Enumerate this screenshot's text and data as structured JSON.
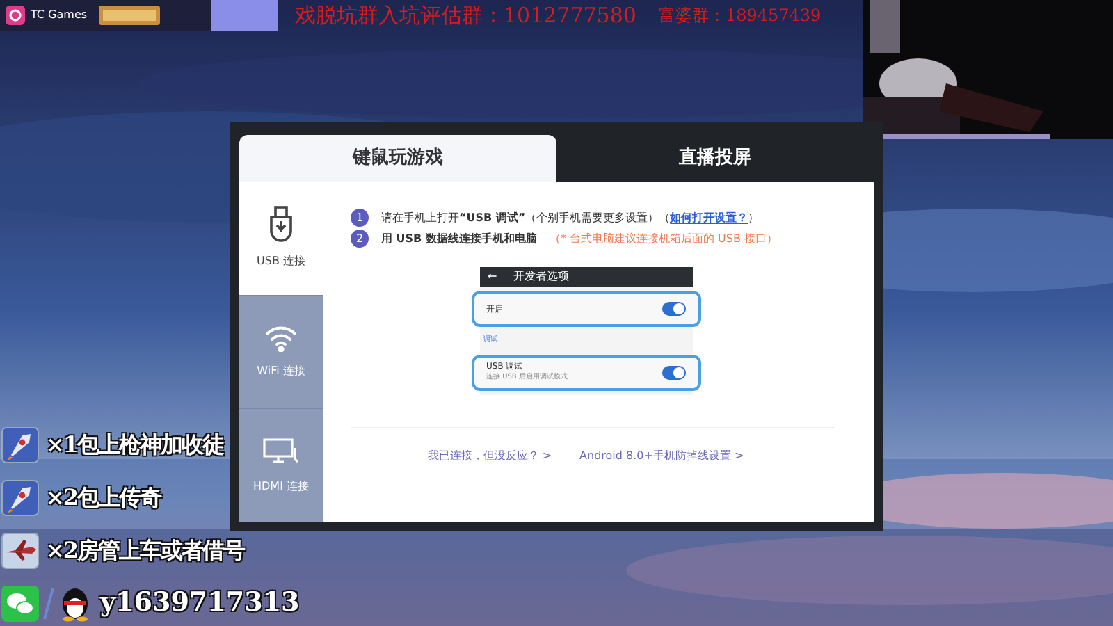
{
  "app_bar": {
    "title": "TC Games"
  },
  "banner": {
    "segments": [
      "戏脱坑群入坑评估群：1012777580",
      "富婆群：189457439"
    ]
  },
  "dialog": {
    "tabs": [
      {
        "label": "键鼠玩游戏",
        "selected": true
      },
      {
        "label": "直播投屏",
        "selected": false
      }
    ],
    "sidebar": [
      {
        "label": "USB 连接",
        "kind": "usb",
        "selected": true
      },
      {
        "label": "WiFi 连接",
        "kind": "wifi",
        "selected": false
      },
      {
        "label": "HDMI 连接",
        "kind": "hdmi",
        "selected": false
      }
    ],
    "steps": [
      {
        "number": "1",
        "text": "请在手机上打开**“USB 调试”**（个别手机需要更多设置）（",
        "link": "如何打开设置？",
        "tail": "）"
      },
      {
        "number": "2",
        "text": "**用 USB 数据线连接手机和电脑**",
        "note": "（* 台式电脑建议连接机箱后面的 USB 接口）"
      }
    ],
    "phone": {
      "back": "←",
      "title": "开发者选项",
      "rows": [
        {
          "kind": "toggle",
          "label": "开启",
          "on": true
        },
        {
          "kind": "section",
          "label": "调试"
        },
        {
          "kind": "toggle",
          "label": "USB 调试",
          "sub": "连接 USB 后启用调试模式",
          "on": true
        }
      ]
    },
    "links": [
      "我已连接，但没反应？ >",
      "Android 8.0+手机防掉线设置 >"
    ]
  },
  "promo": {
    "items": [
      {
        "kind": "rocket",
        "text": "×1包上枪神加收徒"
      },
      {
        "kind": "rocket",
        "text": "×2包上传奇"
      },
      {
        "kind": "jet",
        "text": "×2房管上车或者借号"
      }
    ],
    "contact": "y1639717313"
  }
}
